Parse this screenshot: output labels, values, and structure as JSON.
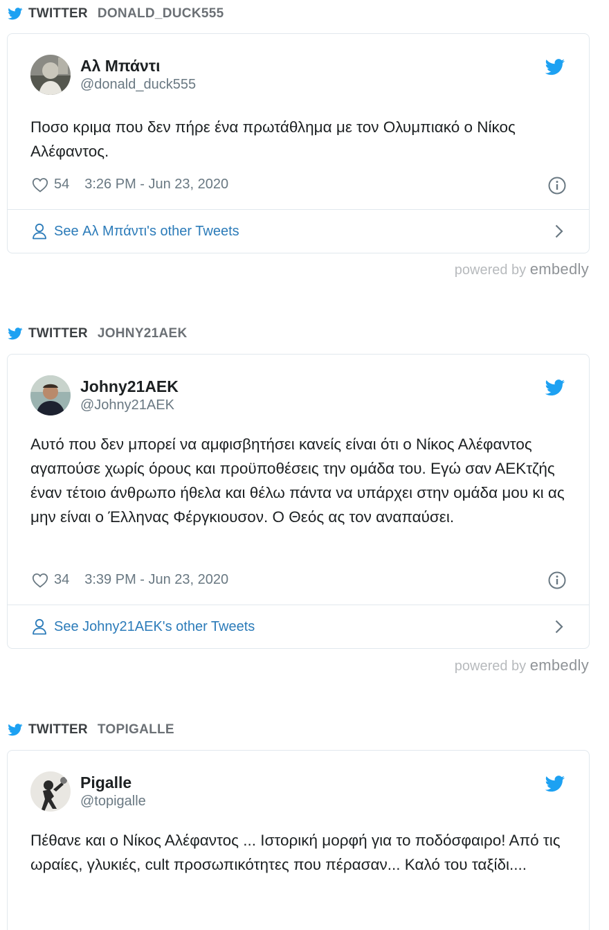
{
  "colors": {
    "twitter_blue": "#1da1f2",
    "link": "#2b7bb9",
    "muted": "#697882",
    "border": "#e1e8ed"
  },
  "embeds": [
    {
      "source_label": "TWITTER",
      "source_user": "DONALD_DUCK555",
      "display_name": "Αλ Μπάντι",
      "handle": "@donald_duck555",
      "text": "Ποσο κριμα που δεν πήρε ένα πρωτάθλημα με τον Ολυμπιακό ο Νίκος Αλέφαντος.",
      "likes": "54",
      "timestamp": "3:26 PM - Jun 23, 2020",
      "see_more": "See Αλ Μπάντι's other Tweets",
      "powered_by": "powered by",
      "brand": "embedly",
      "icons": [
        "twitter-bird-icon",
        "heart-icon",
        "info-icon",
        "person-icon",
        "chevron-right-icon"
      ]
    },
    {
      "source_label": "TWITTER",
      "source_user": "JOHNY21AEK",
      "display_name": "Johny21AEK",
      "handle": "@Johny21AEK",
      "text": "Αυτό που δεν μπορεί να αμφισβητήσει κανείς είναι ότι ο Νίκος Αλέφαντος αγαπούσε χωρίς όρους και προϋποθέσεις την ομάδα του. Εγώ σαν ΑΕΚτζής έναν τέτοιο άνθρωπο ήθελα και θέλω πάντα να υπάρχει στην ομάδα μου κι ας μην είναι ο Έλληνας Φέργκιουσον. Ο Θεός ας τον αναπαύσει.",
      "likes": "34",
      "timestamp": "3:39 PM - Jun 23, 2020",
      "see_more": "See Johny21AEK's other Tweets",
      "powered_by": "powered by",
      "brand": "embedly"
    },
    {
      "source_label": "TWITTER",
      "source_user": "TOPIGALLE",
      "display_name": "Pigalle",
      "handle": "@topigalle",
      "text": "Πέθανε και ο Νίκος Αλέφαντος ... Ιστορική μορφή για το ποδόσφαιρο! Από τις ωραίες, γλυκιές, cult προσωπικότητες που πέρασαν... Καλό του ταξίδι...."
    }
  ]
}
